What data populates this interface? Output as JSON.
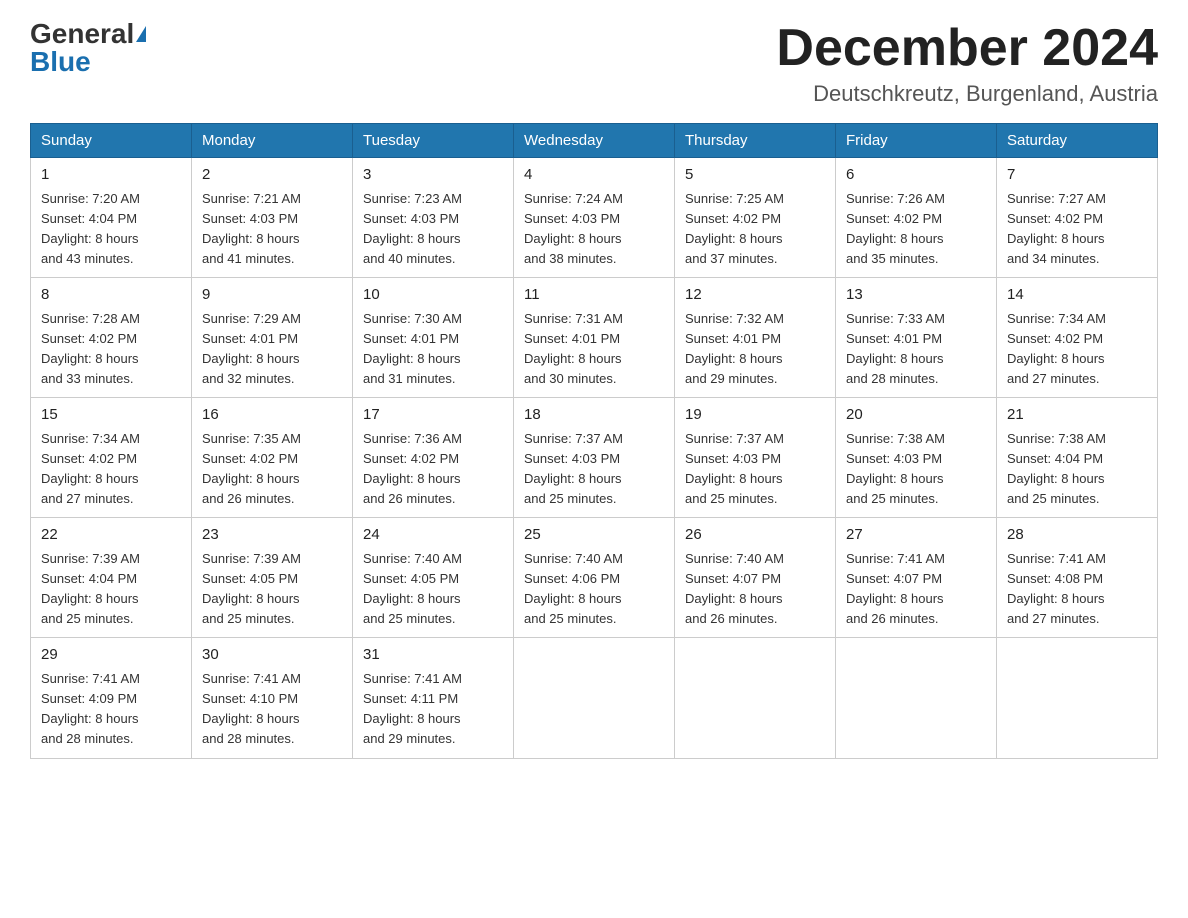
{
  "logo": {
    "general": "General",
    "blue": "Blue"
  },
  "title": {
    "month_year": "December 2024",
    "location": "Deutschkreutz, Burgenland, Austria"
  },
  "weekdays": [
    "Sunday",
    "Monday",
    "Tuesday",
    "Wednesday",
    "Thursday",
    "Friday",
    "Saturday"
  ],
  "weeks": [
    [
      {
        "day": "1",
        "sunrise": "7:20 AM",
        "sunset": "4:04 PM",
        "daylight": "8 hours and 43 minutes."
      },
      {
        "day": "2",
        "sunrise": "7:21 AM",
        "sunset": "4:03 PM",
        "daylight": "8 hours and 41 minutes."
      },
      {
        "day": "3",
        "sunrise": "7:23 AM",
        "sunset": "4:03 PM",
        "daylight": "8 hours and 40 minutes."
      },
      {
        "day": "4",
        "sunrise": "7:24 AM",
        "sunset": "4:03 PM",
        "daylight": "8 hours and 38 minutes."
      },
      {
        "day": "5",
        "sunrise": "7:25 AM",
        "sunset": "4:02 PM",
        "daylight": "8 hours and 37 minutes."
      },
      {
        "day": "6",
        "sunrise": "7:26 AM",
        "sunset": "4:02 PM",
        "daylight": "8 hours and 35 minutes."
      },
      {
        "day": "7",
        "sunrise": "7:27 AM",
        "sunset": "4:02 PM",
        "daylight": "8 hours and 34 minutes."
      }
    ],
    [
      {
        "day": "8",
        "sunrise": "7:28 AM",
        "sunset": "4:02 PM",
        "daylight": "8 hours and 33 minutes."
      },
      {
        "day": "9",
        "sunrise": "7:29 AM",
        "sunset": "4:01 PM",
        "daylight": "8 hours and 32 minutes."
      },
      {
        "day": "10",
        "sunrise": "7:30 AM",
        "sunset": "4:01 PM",
        "daylight": "8 hours and 31 minutes."
      },
      {
        "day": "11",
        "sunrise": "7:31 AM",
        "sunset": "4:01 PM",
        "daylight": "8 hours and 30 minutes."
      },
      {
        "day": "12",
        "sunrise": "7:32 AM",
        "sunset": "4:01 PM",
        "daylight": "8 hours and 29 minutes."
      },
      {
        "day": "13",
        "sunrise": "7:33 AM",
        "sunset": "4:01 PM",
        "daylight": "8 hours and 28 minutes."
      },
      {
        "day": "14",
        "sunrise": "7:34 AM",
        "sunset": "4:02 PM",
        "daylight": "8 hours and 27 minutes."
      }
    ],
    [
      {
        "day": "15",
        "sunrise": "7:34 AM",
        "sunset": "4:02 PM",
        "daylight": "8 hours and 27 minutes."
      },
      {
        "day": "16",
        "sunrise": "7:35 AM",
        "sunset": "4:02 PM",
        "daylight": "8 hours and 26 minutes."
      },
      {
        "day": "17",
        "sunrise": "7:36 AM",
        "sunset": "4:02 PM",
        "daylight": "8 hours and 26 minutes."
      },
      {
        "day": "18",
        "sunrise": "7:37 AM",
        "sunset": "4:03 PM",
        "daylight": "8 hours and 25 minutes."
      },
      {
        "day": "19",
        "sunrise": "7:37 AM",
        "sunset": "4:03 PM",
        "daylight": "8 hours and 25 minutes."
      },
      {
        "day": "20",
        "sunrise": "7:38 AM",
        "sunset": "4:03 PM",
        "daylight": "8 hours and 25 minutes."
      },
      {
        "day": "21",
        "sunrise": "7:38 AM",
        "sunset": "4:04 PM",
        "daylight": "8 hours and 25 minutes."
      }
    ],
    [
      {
        "day": "22",
        "sunrise": "7:39 AM",
        "sunset": "4:04 PM",
        "daylight": "8 hours and 25 minutes."
      },
      {
        "day": "23",
        "sunrise": "7:39 AM",
        "sunset": "4:05 PM",
        "daylight": "8 hours and 25 minutes."
      },
      {
        "day": "24",
        "sunrise": "7:40 AM",
        "sunset": "4:05 PM",
        "daylight": "8 hours and 25 minutes."
      },
      {
        "day": "25",
        "sunrise": "7:40 AM",
        "sunset": "4:06 PM",
        "daylight": "8 hours and 25 minutes."
      },
      {
        "day": "26",
        "sunrise": "7:40 AM",
        "sunset": "4:07 PM",
        "daylight": "8 hours and 26 minutes."
      },
      {
        "day": "27",
        "sunrise": "7:41 AM",
        "sunset": "4:07 PM",
        "daylight": "8 hours and 26 minutes."
      },
      {
        "day": "28",
        "sunrise": "7:41 AM",
        "sunset": "4:08 PM",
        "daylight": "8 hours and 27 minutes."
      }
    ],
    [
      {
        "day": "29",
        "sunrise": "7:41 AM",
        "sunset": "4:09 PM",
        "daylight": "8 hours and 28 minutes."
      },
      {
        "day": "30",
        "sunrise": "7:41 AM",
        "sunset": "4:10 PM",
        "daylight": "8 hours and 28 minutes."
      },
      {
        "day": "31",
        "sunrise": "7:41 AM",
        "sunset": "4:11 PM",
        "daylight": "8 hours and 29 minutes."
      },
      null,
      null,
      null,
      null
    ]
  ],
  "labels": {
    "sunrise": "Sunrise:",
    "sunset": "Sunset:",
    "daylight": "Daylight:"
  }
}
